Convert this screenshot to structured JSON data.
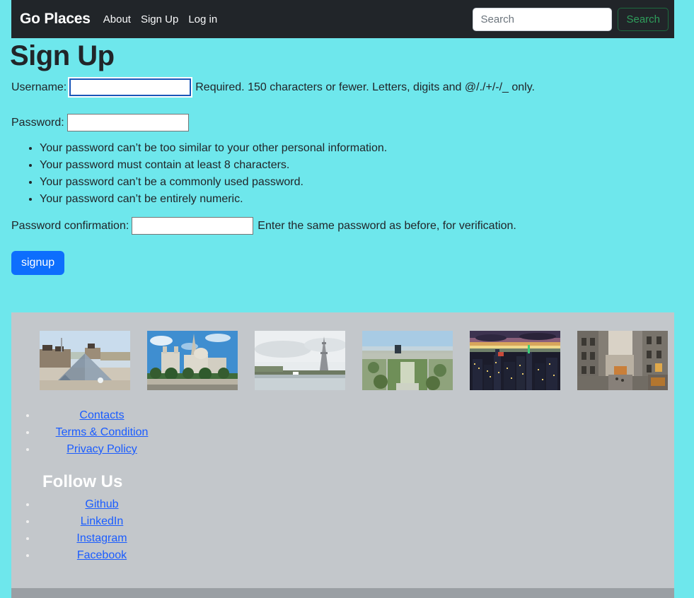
{
  "navbar": {
    "brand": "Go Places",
    "links": [
      {
        "label": "About"
      },
      {
        "label": "Sign Up"
      },
      {
        "label": "Log in"
      }
    ],
    "search": {
      "placeholder": "Search",
      "value": "",
      "button_label": "Search"
    },
    "colors": {
      "background": "#212529",
      "text": "#ffffff",
      "search_button": "#2f9e5c"
    }
  },
  "page": {
    "title": "Sign Up",
    "background": "#6ee7ec"
  },
  "form": {
    "username": {
      "label": "Username:",
      "value": "",
      "focused": true,
      "help": "Required. 150 characters or fewer. Letters, digits and @/./+/-/_ only."
    },
    "password": {
      "label": "Password:",
      "value": "",
      "rules": [
        "Your password can’t be too similar to your other personal information.",
        "Your password must contain at least 8 characters.",
        "Your password can’t be a commonly used password.",
        "Your password can’t be entirely numeric."
      ]
    },
    "password_confirmation": {
      "label": "Password confirmation:",
      "value": "",
      "help": "Enter the same password as before, for verification."
    },
    "submit_label": "signup",
    "submit_color": "#0d6efd"
  },
  "footer": {
    "background": "#c3c7cb",
    "gallery": [
      {
        "name": "louvre-pyramid"
      },
      {
        "name": "notre-dame"
      },
      {
        "name": "eiffel-tower-seine"
      },
      {
        "name": "paris-aerial-champ-de-mars"
      },
      {
        "name": "city-skyline-dusk"
      },
      {
        "name": "paris-street"
      }
    ],
    "links": [
      {
        "label": "Contacts"
      },
      {
        "label": "Terms & Condition"
      },
      {
        "label": "Privacy Policy"
      }
    ],
    "follow_heading": "Follow Us",
    "social": [
      {
        "label": "Github"
      },
      {
        "label": "LinkedIn"
      },
      {
        "label": "Instagram"
      },
      {
        "label": "Facebook"
      }
    ],
    "link_color": "#1a5cff"
  }
}
